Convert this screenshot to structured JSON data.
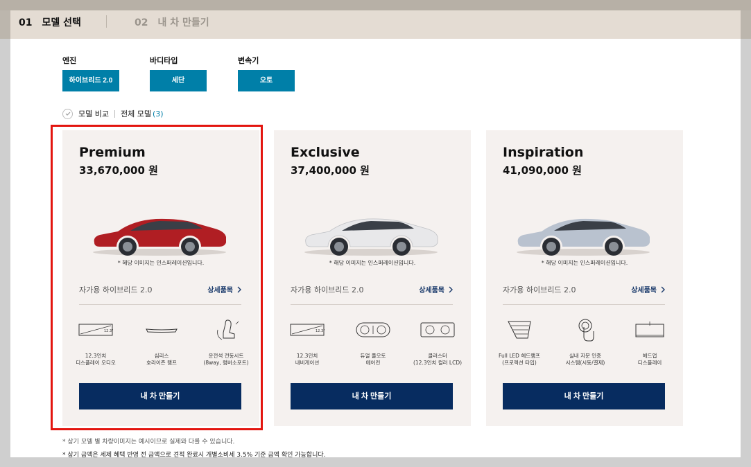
{
  "steps": [
    {
      "num": "01",
      "label": "모델 선택"
    },
    {
      "num": "02",
      "label": "내 차 만들기"
    }
  ],
  "filters": [
    {
      "label": "엔진",
      "value": "하이브리드 2.0"
    },
    {
      "label": "바디타입",
      "value": "세단"
    },
    {
      "label": "변속기",
      "value": "오토"
    }
  ],
  "compare": {
    "label": "모델 비교",
    "all_models": "전체 모델",
    "count": "(3)"
  },
  "cards": [
    {
      "name": "Premium",
      "price": "33,670,000 원",
      "car_color": "#b01e23",
      "disclaimer": "* 해당 이미지는 인스퍼레이션입니다.",
      "engine": "자가용 하이브리드 2.0",
      "detail": "상세품목",
      "features": [
        {
          "icon": "display-icon",
          "label": "12.3인치\n디스플레이 오디오"
        },
        {
          "icon": "lamp-icon",
          "label": "심리스\n호라이즌 램프"
        },
        {
          "icon": "seat-icon",
          "label": "운전석 전동시트\n(8way, 럼버소포트)"
        }
      ],
      "cta": "내 차 만들기"
    },
    {
      "name": "Exclusive",
      "price": "37,400,000 원",
      "car_color": "#e8e8ea",
      "disclaimer": "* 해당 이미지는 인스퍼레이션입니다.",
      "engine": "자가용 하이브리드 2.0",
      "detail": "상세품목",
      "features": [
        {
          "icon": "navigation-icon",
          "label": "12.3인치\n내비게이션"
        },
        {
          "icon": "aircon-icon",
          "label": "듀얼 풀오토\n에어컨"
        },
        {
          "icon": "cluster-icon",
          "label": "클러스터\n(12.3인치 컬러 LCD)"
        }
      ],
      "cta": "내 차 만들기"
    },
    {
      "name": "Inspiration",
      "price": "41,090,000 원",
      "car_color": "#b9c2cf",
      "disclaimer": "* 해당 이미지는 인스퍼레이션입니다.",
      "engine": "자가용 하이브리드 2.0",
      "detail": "상세품목",
      "features": [
        {
          "icon": "headlamp-icon",
          "label": "Full LED 헤드램프\n(프로젝션 타입)"
        },
        {
          "icon": "fingerprint-icon",
          "label": "실내 지문 인증\n시스템(시동/결제)"
        },
        {
          "icon": "hud-icon",
          "label": "헤드업\n디스플레이"
        }
      ],
      "cta": "내 차 만들기"
    }
  ],
  "notes": [
    "* 상기 모델 별 차량이미지는 예시이므로 실제와 다를 수 있습니다.",
    "* 상기 금액은 세제 혜택 반영 전 금액으로 견적 완료시 개별소비세 3.5% 기준 금액 확인 가능합니다."
  ],
  "colors": {
    "accent": "#007fa8",
    "cta": "#072c60",
    "card_bg": "#f5f1ef",
    "step_bar": "#e4dcd3",
    "highlight": "#e3150f"
  }
}
